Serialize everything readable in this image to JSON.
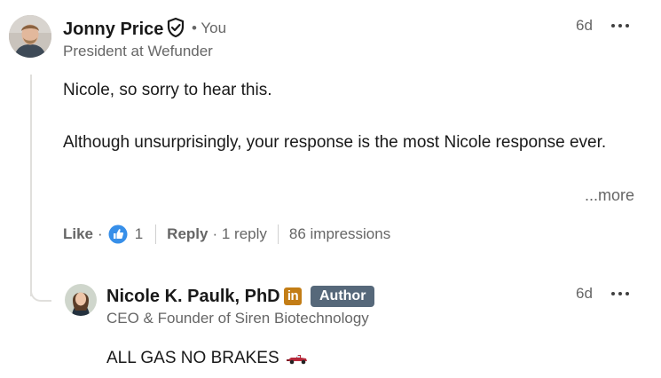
{
  "comment": {
    "author": {
      "name": "Jonny Price",
      "relation": "• You",
      "headline": "President at Wefunder",
      "avatar_icon": "person-avatar"
    },
    "timestamp": "6d",
    "body": {
      "line1": "Nicole, so sorry to hear this.",
      "line2": "Although unsurprisingly, your response is the most Nicole response ever.",
      "more_label": "...more"
    },
    "actions": {
      "like_label": "Like",
      "like_separator": "·",
      "like_count": "1",
      "reply_label": "Reply",
      "reply_count": "· 1 reply",
      "impressions": "86 impressions"
    }
  },
  "reply": {
    "author": {
      "name": "Nicole K. Paulk, PhD",
      "badge": "Author",
      "headline": "CEO & Founder of Siren Biotechnology",
      "logo_text": "in"
    },
    "timestamp": "6d",
    "body": "ALL GAS NO BRAKES"
  },
  "colors": {
    "reaction_blue": "#378fe9",
    "author_badge": "#56687a",
    "linkedin_premium": "#c37d16"
  }
}
